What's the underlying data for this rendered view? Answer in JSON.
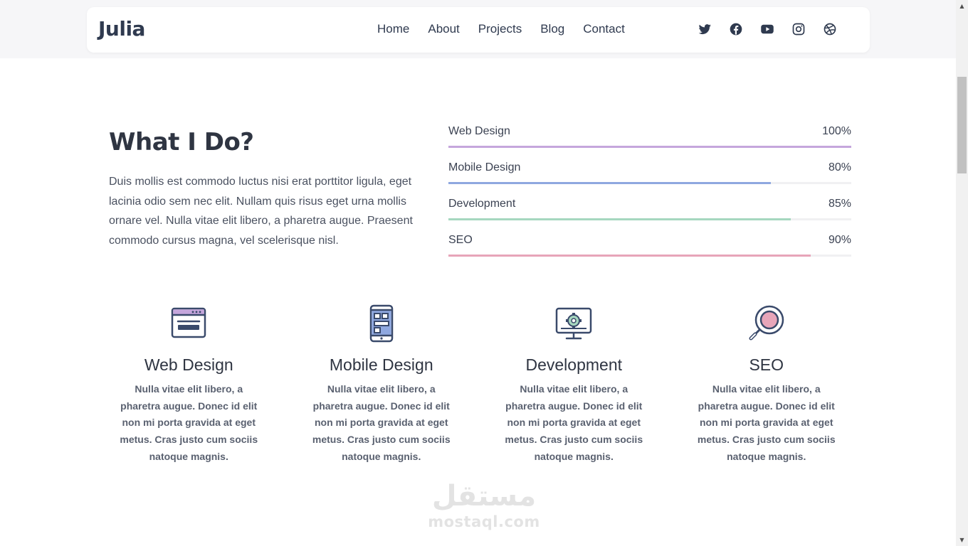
{
  "nav": {
    "brand": "Julia",
    "items": [
      {
        "label": "Home"
      },
      {
        "label": "About"
      },
      {
        "label": "Projects"
      },
      {
        "label": "Blog"
      },
      {
        "label": "Contact"
      }
    ],
    "socials": [
      {
        "icon": "twitter-icon"
      },
      {
        "icon": "facebook-icon"
      },
      {
        "icon": "youtube-icon"
      },
      {
        "icon": "instagram-icon"
      },
      {
        "icon": "dribbble-icon"
      }
    ]
  },
  "intro": {
    "title": "What I Do?",
    "text": "Duis mollis est commodo luctus nisi erat porttitor ligula, eget lacinia odio sem nec elit. Nullam quis risus eget urna mollis ornare vel. Nulla vitae elit libero, a pharetra augue. Praesent commodo cursus magna, vel scelerisque nisl."
  },
  "skills": [
    {
      "label": "Web Design",
      "percent_label": "100%",
      "value": 100,
      "color": "#c5a6dc"
    },
    {
      "label": "Mobile Design",
      "percent_label": "80%",
      "value": 80,
      "color": "#8fa8e0"
    },
    {
      "label": "Development",
      "percent_label": "85%",
      "value": 85,
      "color": "#a6d7bf"
    },
    {
      "label": "SEO",
      "percent_label": "90%",
      "value": 90,
      "color": "#e7a5b9"
    }
  ],
  "services": [
    {
      "title": "Web Design",
      "icon": "browser-window-icon",
      "text": "Nulla vitae elit libero, a pharetra augue. Donec id elit non mi porta gravida at eget metus. Cras justo cum sociis natoque magnis."
    },
    {
      "title": "Mobile Design",
      "icon": "smartphone-icon",
      "text": "Nulla vitae elit libero, a pharetra augue. Donec id elit non mi porta gravida at eget metus. Cras justo cum sociis natoque magnis."
    },
    {
      "title": "Development",
      "icon": "monitor-code-icon",
      "text": "Nulla vitae elit libero, a pharetra augue. Donec id elit non mi porta gravida at eget metus. Cras justo cum sociis natoque magnis."
    },
    {
      "title": "SEO",
      "icon": "magnifier-icon",
      "text": "Nulla vitae elit libero, a pharetra augue. Donec id elit non mi porta gravida at eget metus. Cras justo cum sociis natoque magnis."
    }
  ],
  "watermark": {
    "arabic": "مستقل",
    "latin": "mostaql.com"
  },
  "colors": {
    "accent_purple": "#c5a6dc",
    "accent_blue": "#8fa8e0",
    "accent_green": "#a6d7bf",
    "accent_pink": "#e7a5b9",
    "icon_navy": "#3a4a6b"
  }
}
